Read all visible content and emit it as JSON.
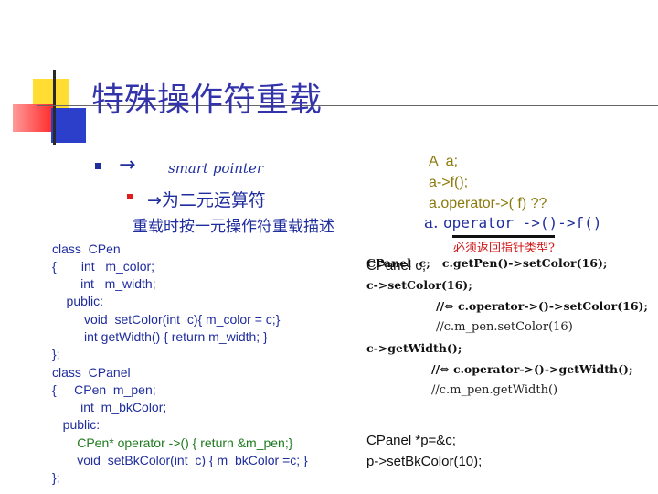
{
  "title": "特殊操作符重载",
  "bullet1": {
    "arrow": "→",
    "text": "smart pointer"
  },
  "bullet2": {
    "text": "→为二元运算符",
    "continuation": "重载时按一元操作符重载描述"
  },
  "example": {
    "line1": "A  a;",
    "line2": "a->f();",
    "line3": "a.operator->( f) ??",
    "op_prefix": "a. ",
    "op_code": "operator ->()->f()",
    "note": "必须返回指针类型?"
  },
  "code_left": [
    "class  CPen",
    "{       int   m_color;",
    "        int   m_width;",
    "    public:",
    "         void  setColor(int  c){ m_color = c;}",
    "         int getWidth() { return m_width; }",
    "};",
    "class  CPanel",
    "{     CPen  m_pen;",
    "        int  m_bkColor;",
    "   public:",
    "       CPen* operator ->() { return &m_pen;}",
    "       void  setBkColor(int  c) { m_bkColor =c; }",
    "};"
  ],
  "code_right": {
    "overlap_a": "CPanel c;",
    "overlap_b": "CPanel  c;   c.getPen()->setColor(16);",
    "l2": "c->setColor(16);",
    "l3": "//⇔ c.operator->()->setColor(16);",
    "l4": "//c.m_pen.setColor(16)",
    "l5": "c->getWidth();",
    "l6": "//⇔ c.operator->()->getWidth();",
    "l7": "//c.m_pen.getWidth()",
    "l8": "CPanel *p=&c;",
    "l9": "p->setBkColor(10);"
  }
}
